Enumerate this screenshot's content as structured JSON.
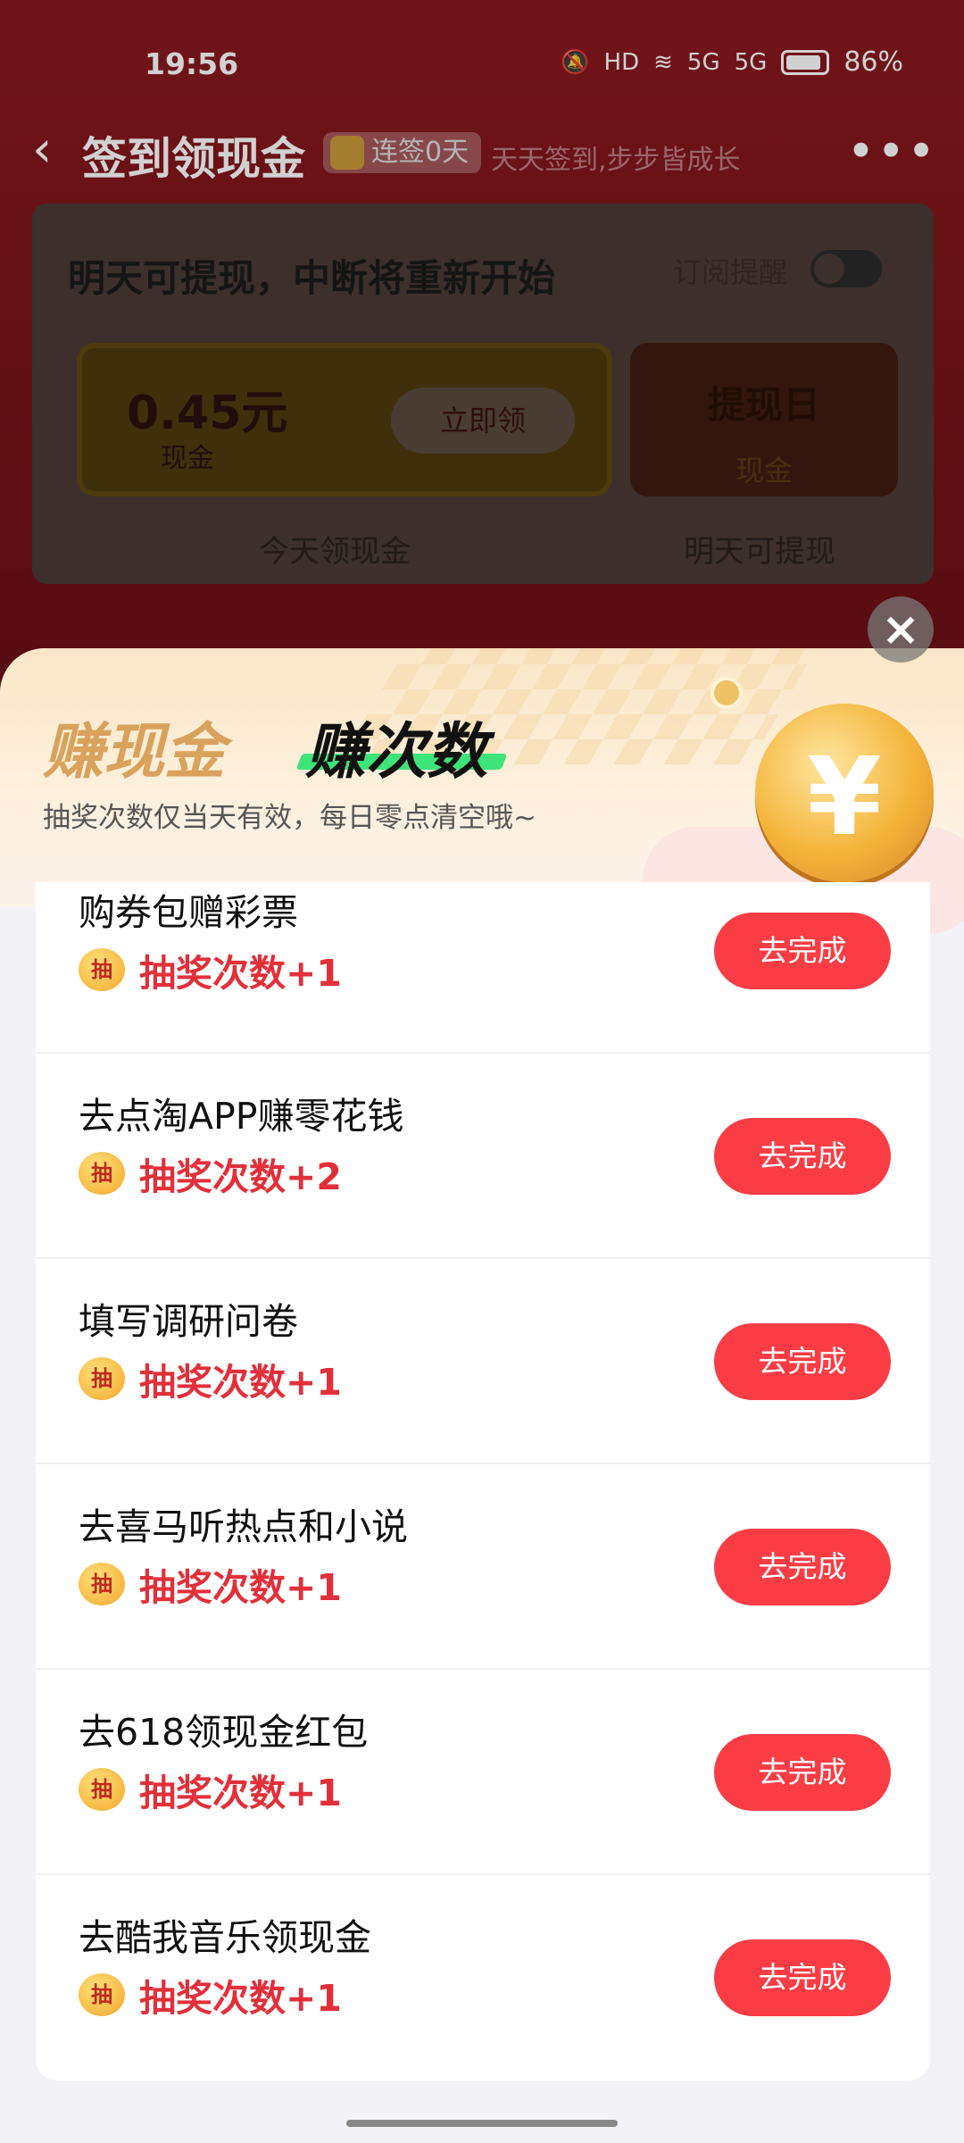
{
  "status_bar": {
    "time": "19:56",
    "battery": "86%",
    "network1": "5G",
    "network2": "5G",
    "hd": "HD"
  },
  "nav": {
    "title": "签到领现金",
    "streak": "连签0天",
    "slogan": "天天签到,步步皆成长"
  },
  "checkin": {
    "headline": "明天可提现，中断将重新开始",
    "subscribe_label": "订阅提醒",
    "amount": "0.45元",
    "amount_unit": "现金",
    "claim_label": "立即领",
    "payday_title": "提现日",
    "payday_sub": "现金",
    "label_today": "今天领现金",
    "label_tomorrow": "明天可提现"
  },
  "sheet": {
    "tab_cash": "赚现金",
    "tab_count": "赚次数",
    "hint": "抽奖次数仅当天有效，每日零点清空哦~",
    "coin_symbol": "¥"
  },
  "tasks": [
    {
      "title": "购券包赠彩票",
      "reward": "抽奖次数+1",
      "button": "去完成",
      "badge": "抽"
    },
    {
      "title": "去点淘APP赚零花钱",
      "reward": "抽奖次数+2",
      "button": "去完成",
      "badge": "抽"
    },
    {
      "title": "填写调研问卷",
      "reward": "抽奖次数+1",
      "button": "去完成",
      "badge": "抽"
    },
    {
      "title": "去喜马听热点和小说",
      "reward": "抽奖次数+1",
      "button": "去完成",
      "badge": "抽"
    },
    {
      "title": "去618领现金红包",
      "reward": "抽奖次数+1",
      "button": "去完成",
      "badge": "抽"
    },
    {
      "title": "去酷我音乐领现金",
      "reward": "抽奖次数+1",
      "button": "去完成",
      "badge": "抽"
    }
  ],
  "colors": {
    "accent": "#fa3d45",
    "reward_text": "#e2303a",
    "tab_underline": "#3ee37a"
  }
}
